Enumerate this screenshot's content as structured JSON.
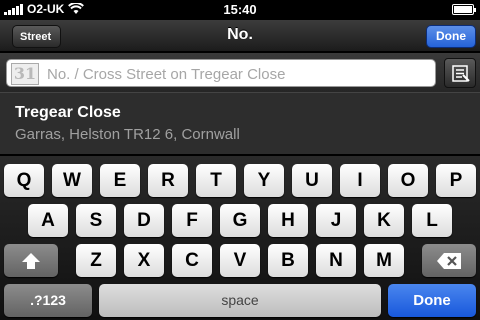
{
  "status_bar": {
    "carrier": "O2-UK",
    "time": "15:40",
    "battery_level": 1.0
  },
  "nav": {
    "back_label": "Street",
    "title": "No.",
    "done_label": "Done"
  },
  "search": {
    "calendar_glyph": "31",
    "placeholder": "No. / Cross Street on Tregear Close",
    "value": ""
  },
  "result": {
    "title": "Tregear Close",
    "subtitle": "Garras, Helston TR12 6, Cornwall"
  },
  "keyboard": {
    "row1": [
      "Q",
      "W",
      "E",
      "R",
      "T",
      "Y",
      "U",
      "I",
      "O",
      "P"
    ],
    "row2": [
      "A",
      "S",
      "D",
      "F",
      "G",
      "H",
      "J",
      "K",
      "L"
    ],
    "row3": [
      "Z",
      "X",
      "C",
      "V",
      "B",
      "N",
      "M"
    ],
    "numbers_label": ".?123",
    "space_label": "space",
    "done_label": "Done"
  },
  "colors": {
    "accent_blue": "#2563d8"
  }
}
